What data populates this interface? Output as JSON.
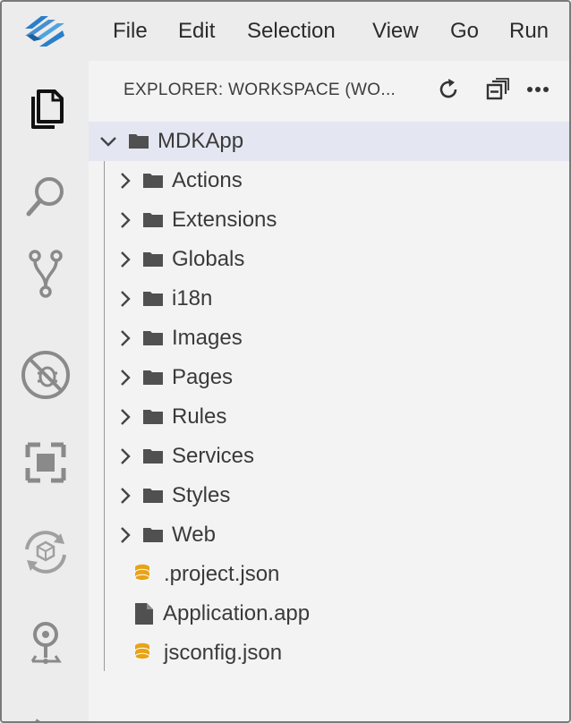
{
  "menu": {
    "items": [
      "File",
      "Edit",
      "Selection",
      "View",
      "Go",
      "Run"
    ]
  },
  "activity_bar": {
    "icons": [
      "explorer-icon",
      "search-icon",
      "source-control-icon",
      "debug-icon",
      "extensions-icon",
      "sync-icon",
      "deploy-icon",
      "run-icon"
    ],
    "active": "explorer-icon"
  },
  "explorer": {
    "title": "EXPLORER: WORKSPACE (WO...",
    "actions": [
      "refresh-icon",
      "collapse-all-icon",
      "more-icon"
    ],
    "root": {
      "label": "MDKApp",
      "expanded": true
    },
    "folders": [
      "Actions",
      "Extensions",
      "Globals",
      "i18n",
      "Images",
      "Pages",
      "Rules",
      "Services",
      "Styles",
      "Web"
    ],
    "files": [
      {
        "label": ".project.json",
        "icon": "database-icon"
      },
      {
        "label": "Application.app",
        "icon": "file-icon"
      },
      {
        "label": "jsconfig.json",
        "icon": "database-icon"
      }
    ]
  },
  "colors": {
    "root_highlight": "#e4e6f1",
    "file_json_icon": "#e8a317",
    "logo_blue": "#2a7fc9"
  }
}
